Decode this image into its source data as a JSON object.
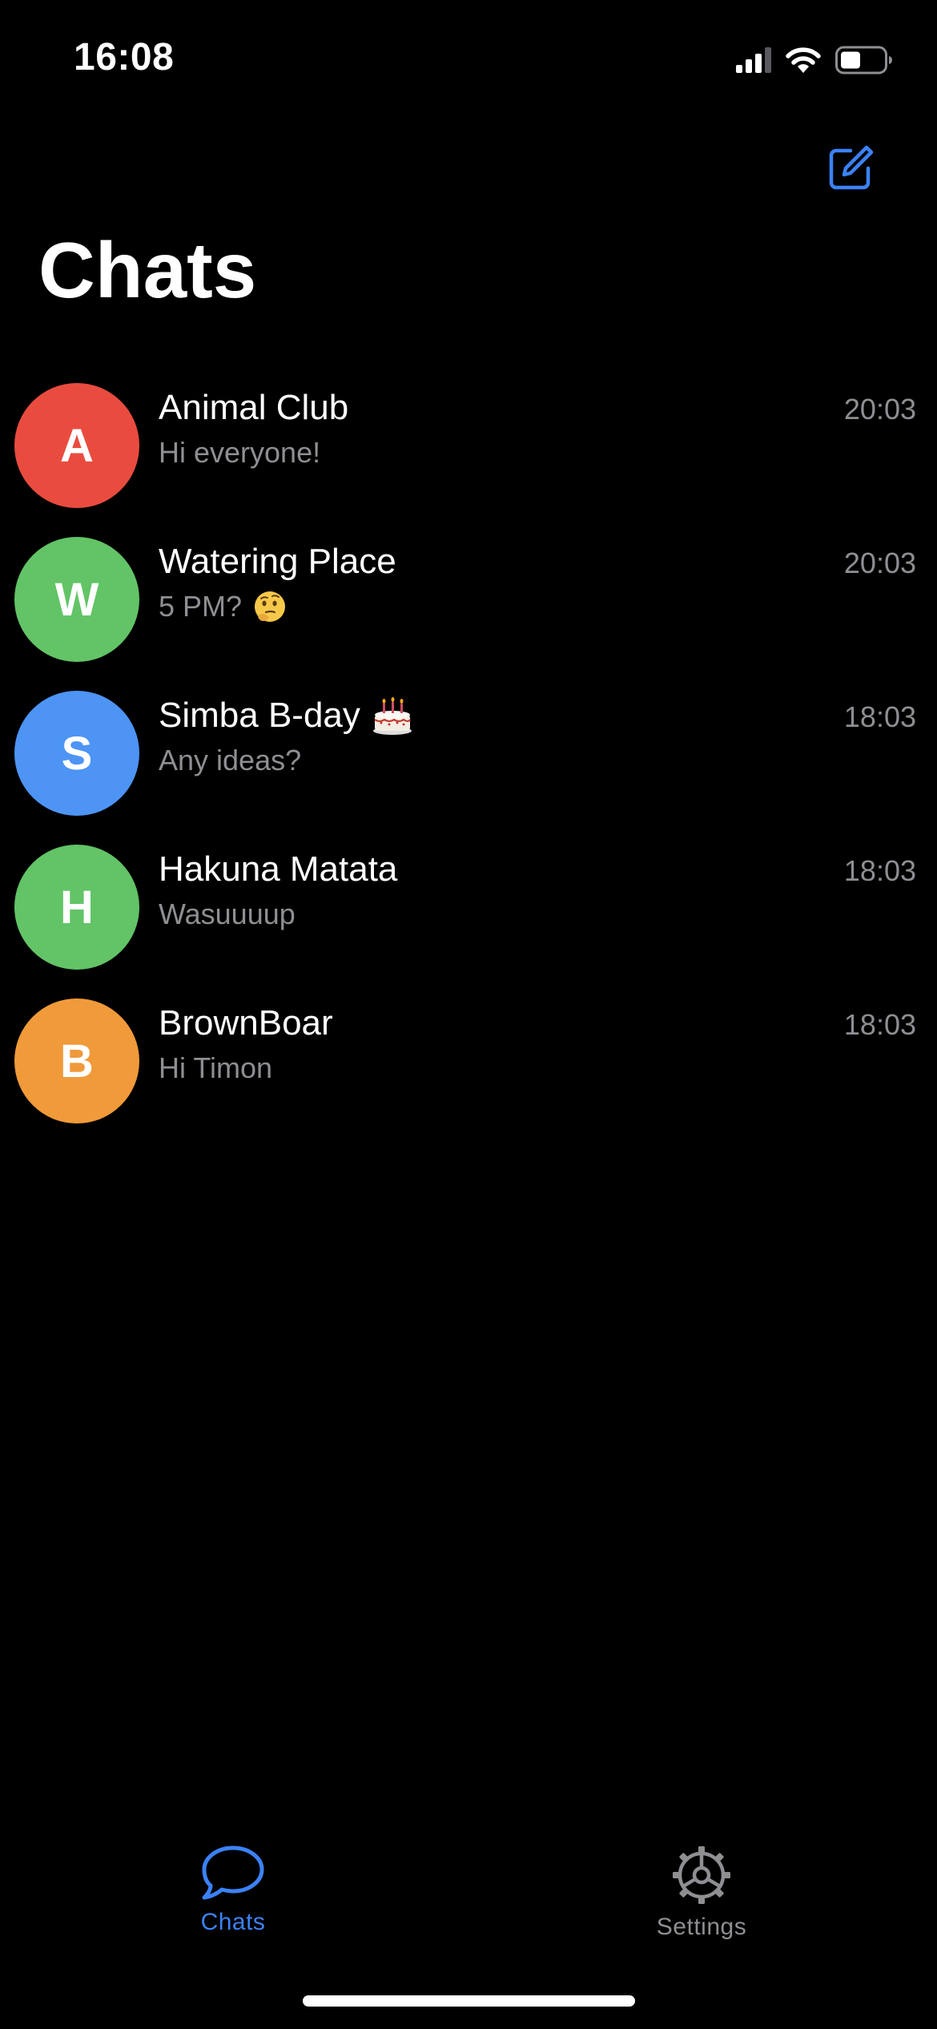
{
  "status_bar": {
    "time": "16:08",
    "icons": [
      "cellular-signal-icon",
      "wifi-icon",
      "battery-icon"
    ]
  },
  "header": {
    "compose_icon": "compose-icon",
    "title": "Chats"
  },
  "colors": {
    "accent": "#3b82f6",
    "secondary_text": "#8e8e93",
    "background": "#000000"
  },
  "chats": [
    {
      "initial": "A",
      "color": "#e94c3f",
      "name": "Animal Club",
      "name_emoji": "",
      "preview": "Hi everyone!",
      "preview_emoji": "",
      "time": "20:03"
    },
    {
      "initial": "W",
      "color": "#62c466",
      "name": "Watering Place",
      "name_emoji": "",
      "preview": "5 PM?",
      "preview_emoji": "thinking-face-emoji",
      "time": "20:03"
    },
    {
      "initial": "S",
      "color": "#4d94f5",
      "name": "Simba B-day",
      "name_emoji": "birthday-cake-emoji",
      "preview": "Any ideas?",
      "preview_emoji": "",
      "time": "18:03"
    },
    {
      "initial": "H",
      "color": "#62c466",
      "name": "Hakuna Matata",
      "name_emoji": "",
      "preview": "Wasuuuup",
      "preview_emoji": "",
      "time": "18:03"
    },
    {
      "initial": "B",
      "color": "#f09a3a",
      "name": "BrownBoar",
      "name_emoji": "",
      "preview": "Hi Timon",
      "preview_emoji": "",
      "time": "18:03"
    }
  ],
  "tab_bar": {
    "tabs": [
      {
        "label": "Chats",
        "icon": "chat-bubble-icon",
        "active": true
      },
      {
        "label": "Settings",
        "icon": "gear-icon",
        "active": false
      }
    ]
  }
}
